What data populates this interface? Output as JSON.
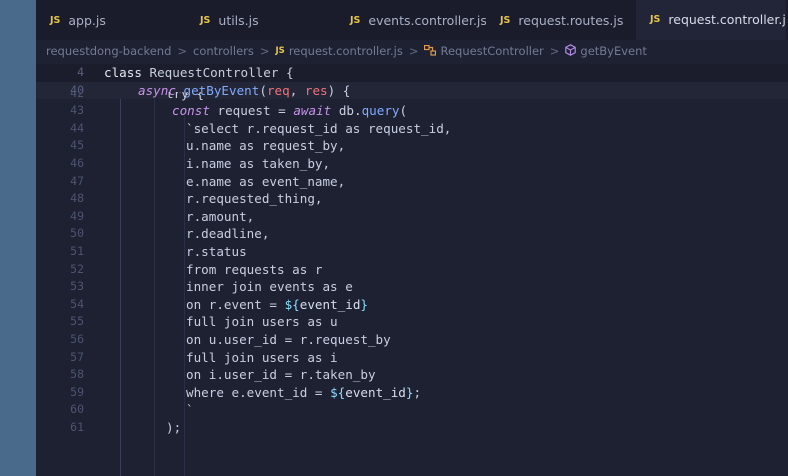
{
  "tabs": [
    {
      "label": "app.js",
      "badge": "JS",
      "modified": ""
    },
    {
      "label": "utils.js",
      "badge": "JS",
      "modified": ""
    },
    {
      "label": "events.controller.js",
      "badge": "JS",
      "modified": ""
    },
    {
      "label": "request.routes.js",
      "badge": "JS",
      "modified": ""
    },
    {
      "label": "request.controller.js",
      "badge": "JS",
      "modified": "M",
      "active": true
    }
  ],
  "breadcrumb": {
    "project": "requestdong-backend",
    "folder": "controllers",
    "file_badge": "JS",
    "file": "request.controller.js",
    "class": "RequestController",
    "method": "getByEvent",
    "separator": ">"
  },
  "code": {
    "sticky": [
      {
        "number": "4",
        "text": "class RequestController {"
      },
      {
        "number": "40",
        "text": "async getByEvent(req, res) {"
      }
    ],
    "lines": [
      {
        "number": "42",
        "text": "try {"
      },
      {
        "number": "43",
        "text": "const request = await db.query("
      },
      {
        "number": "44",
        "text": "`select r.request_id as request_id,"
      },
      {
        "number": "45",
        "text": "u.name as request_by,"
      },
      {
        "number": "46",
        "text": "i.name as taken_by,"
      },
      {
        "number": "47",
        "text": "e.name as event_name,"
      },
      {
        "number": "48",
        "text": "r.requested_thing,"
      },
      {
        "number": "49",
        "text": "r.amount,"
      },
      {
        "number": "50",
        "text": "r.deadline,"
      },
      {
        "number": "51",
        "text": "r.status"
      },
      {
        "number": "52",
        "text": "from requests as r"
      },
      {
        "number": "53",
        "text": "inner join events as e"
      },
      {
        "number": "54",
        "text": "on r.event = ${event_id}"
      },
      {
        "number": "55",
        "text": "full join users as u"
      },
      {
        "number": "56",
        "text": "on u.user_id = r.request_by"
      },
      {
        "number": "57",
        "text": "full join users as i"
      },
      {
        "number": "58",
        "text": "on i.user_id = r.taken_by"
      },
      {
        "number": "59",
        "text": "where e.event_id = ${event_id};"
      },
      {
        "number": "60",
        "text": "`"
      },
      {
        "number": "61",
        "text": ");"
      }
    ]
  },
  "colors": {
    "tab_icon": "#e8c547",
    "keyword": "#c792ea",
    "function": "#82aaff",
    "param": "#f07178",
    "string": "#c3e88d",
    "template_expr": "#89ddff"
  }
}
